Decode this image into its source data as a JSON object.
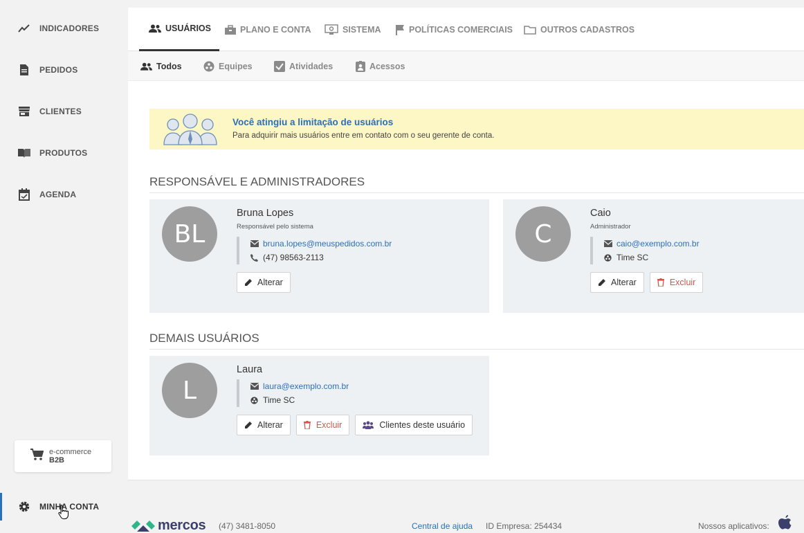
{
  "sidebar": {
    "items": [
      {
        "label": "INDICADORES",
        "icon": "trend-icon"
      },
      {
        "label": "PEDIDOS",
        "icon": "document-icon"
      },
      {
        "label": "CLIENTES",
        "icon": "store-icon"
      },
      {
        "label": "PRODUTOS",
        "icon": "book-icon"
      },
      {
        "label": "AGENDA",
        "icon": "calendar-icon"
      }
    ],
    "ecommerce": {
      "line1": "e-commerce",
      "line2": "B2B"
    },
    "account_label": "MINHA CONTA"
  },
  "tabs": [
    {
      "label": "USUÁRIOS",
      "active": true
    },
    {
      "label": "PLANO E CONTA"
    },
    {
      "label": "SISTEMA"
    },
    {
      "label": "POLÍTICAS COMERCIAIS"
    },
    {
      "label": "OUTROS CADASTROS"
    }
  ],
  "subtabs": [
    {
      "label": "Todos",
      "active": true
    },
    {
      "label": "Equipes"
    },
    {
      "label": "Atividades"
    },
    {
      "label": "Acessos"
    }
  ],
  "alert": {
    "title": "Você atingiu a limitação de usuários",
    "text": "Para adquirir mais usuários entre em contato com o seu gerente de conta."
  },
  "sections": {
    "admins_title": "RESPONSÁVEL E ADMINISTRADORES",
    "others_title": "DEMAIS USUÁRIOS"
  },
  "users": [
    {
      "initials": "BL",
      "name": "Bruna Lopes",
      "role": "Responsável pelo sistema",
      "email": "bruna.lopes@meuspedidos.com.br",
      "phone": "(47) 98563-2113"
    },
    {
      "initials": "C",
      "name": "Caio",
      "role": "Administrador",
      "email": "caio@exemplo.com.br",
      "team": "Time SC"
    },
    {
      "initials": "L",
      "name": "Laura",
      "email": "laura@exemplo.com.br",
      "team": "Time SC"
    }
  ],
  "buttons": {
    "edit": "Alterar",
    "delete": "Excluir",
    "clients": "Clientes deste usuário"
  },
  "footer": {
    "brand": "mercos",
    "phone": "(47) 3481-8050",
    "help": "Central de ajuda",
    "company_id": "ID Empresa: 254434",
    "apps": "Nossos aplicativos:"
  },
  "colors": {
    "accent": "#2c6fb7",
    "alert_bg": "#fdf6c5",
    "danger": "#d9534f",
    "card_bg": "#eef1f4"
  }
}
